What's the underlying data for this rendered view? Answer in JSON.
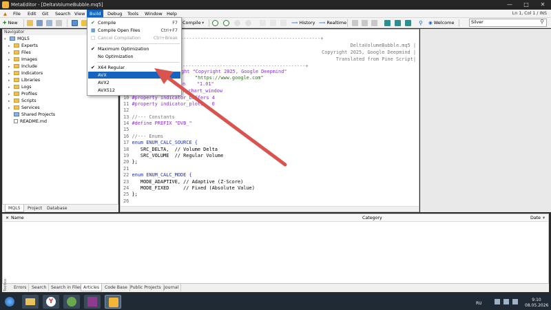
{
  "window": {
    "title": "MetaEditor - [DeltaVolumeBubble.mq5]"
  },
  "menu": {
    "items": [
      "File",
      "Edit",
      "Git",
      "Search",
      "View",
      "Build",
      "Debug",
      "Tools",
      "Window",
      "Help"
    ],
    "active": "Build",
    "status": "Ln 1, Col 1 / INS"
  },
  "toolbar": {
    "new_label": "New",
    "compile_label": "Compile",
    "history_label": "History",
    "realtime_label": "Realtime",
    "welcome_label": "Welcome",
    "search_value": "Silver"
  },
  "build_menu": {
    "compile": {
      "label": "Compile",
      "shortcut": "F7"
    },
    "compile_open": {
      "label": "Compile Open Files",
      "shortcut": "Ctrl+F7"
    },
    "cancel": {
      "label": "Cancel Compilation",
      "shortcut": "Ctrl+Break"
    },
    "max_opt": {
      "label": "Maximum Optimization",
      "checked": true
    },
    "no_opt": {
      "label": "No Optimization"
    },
    "x64": {
      "label": "X64 Regular",
      "checked": true
    },
    "avx": {
      "label": "AVX"
    },
    "avx2": {
      "label": "AVX2"
    },
    "avx512": {
      "label": "AVX512"
    }
  },
  "navigator": {
    "title": "Navigator",
    "root": "MQL5",
    "items": [
      "Experts",
      "Files",
      "Images",
      "Include",
      "Indicators",
      "Libraries",
      "Logs",
      "Profiles",
      "Scripts",
      "Services",
      "Shared Projects",
      "README.md"
    ],
    "tabs": [
      "MQL5",
      "Project",
      "Database"
    ]
  },
  "editor": {
    "header_lines": [
      "DeltaVolumeBubble.mq5 |",
      "Copyright 2025, Google Deepmind |",
      "Translated from Pine Script|"
    ],
    "lines": [
      {
        "n": "",
        "t": "ght \"Copyright 2025, Google Deepmind\""
      },
      {
        "n": "",
        "t": "\"https://www.google.com\""
      },
      {
        "n": "",
        "t": "n    \"1.01\""
      },
      {
        "n": "",
        "t": "r_chart_window"
      },
      {
        "n": "10",
        "t": "#property indicator_buffers 4"
      },
      {
        "n": "11",
        "t": "#property indicator_plots   0"
      },
      {
        "n": "12",
        "t": ""
      },
      {
        "n": "13",
        "t": "//--- Constants"
      },
      {
        "n": "14",
        "t": "#define PREFIX \"DVB_\""
      },
      {
        "n": "15",
        "t": ""
      },
      {
        "n": "16",
        "t": "//--- Enums"
      },
      {
        "n": "17",
        "t": "enum ENUM_CALC_SOURCE {"
      },
      {
        "n": "18",
        "t": "   SRC_DELTA,  // Volume Delta"
      },
      {
        "n": "19",
        "t": "   SRC_VOLUME  // Regular Volume"
      },
      {
        "n": "20",
        "t": "};"
      },
      {
        "n": "21",
        "t": ""
      },
      {
        "n": "22",
        "t": "enum ENUM_CALC_MODE {"
      },
      {
        "n": "23",
        "t": "   MODE_ADAPTIVE, // Adaptive (Z-Score)"
      },
      {
        "n": "24",
        "t": "   MODE_FIXED     // Fixed (Absolute Value)"
      },
      {
        "n": "25",
        "t": "};"
      },
      {
        "n": "26",
        "t": ""
      }
    ]
  },
  "toolbox": {
    "columns": [
      "Name",
      "Category",
      "Date"
    ],
    "tabs": [
      "Errors",
      "Search",
      "Search in Files",
      "Articles",
      "Code Base",
      "Public Projects",
      "Journal"
    ],
    "selected_tab": "Articles",
    "side_label": "Toolbox"
  },
  "taskbar": {
    "lang": "RU",
    "time": "9:10",
    "date": "08.05.2026"
  },
  "colors": {
    "accent": "#1565c0",
    "arrow": "#d9534f"
  }
}
